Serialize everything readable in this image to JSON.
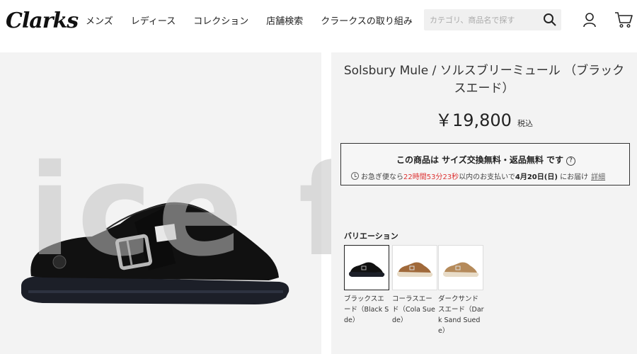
{
  "brand": {
    "logo_text": "Clarks"
  },
  "nav": {
    "items": [
      {
        "label": "メンズ"
      },
      {
        "label": "レディース"
      },
      {
        "label": "コレクション"
      },
      {
        "label": "店舗検索"
      },
      {
        "label": "クラークスの取り組み"
      }
    ]
  },
  "search": {
    "placeholder": "カテゴリ、商品名で探す",
    "icon": "search-icon"
  },
  "header_icons": {
    "account": "user-icon",
    "cart": "cart-icon"
  },
  "product": {
    "title": "Solsbury Mule / ソルスブリーミュール （ブラックスエード）",
    "price": "￥19,800",
    "tax_label": "税込"
  },
  "shipping": {
    "headline_prefix": "この商品は ",
    "headline_bold": "サイズ交換無料・返品無料",
    "headline_suffix": " です",
    "help_glyph": "?",
    "delivery_prefix": "お急ぎ便なら",
    "countdown": "22時間53分23秒",
    "delivery_middle": "以内のお支払いで",
    "delivery_date": "4月20日(日)",
    "delivery_suffix": "にお届け",
    "detail_link": "詳細"
  },
  "variations": {
    "label": "バリエーション",
    "items": [
      {
        "name": "ブラックスエード（Black Sde）",
        "color": "#111111",
        "selected": true
      },
      {
        "name": "コーラスエード（Cola Suede）",
        "color": "#a0693a",
        "selected": false
      },
      {
        "name": "ダークサンドスエード（Dark Sand Suede）",
        "color": "#b58a5a",
        "selected": false
      }
    ]
  },
  "watermark": {
    "text": "ice field"
  },
  "colors": {
    "panel_bg": "#f3f3f3",
    "accent_red": "#dd3333",
    "text": "#222222"
  }
}
